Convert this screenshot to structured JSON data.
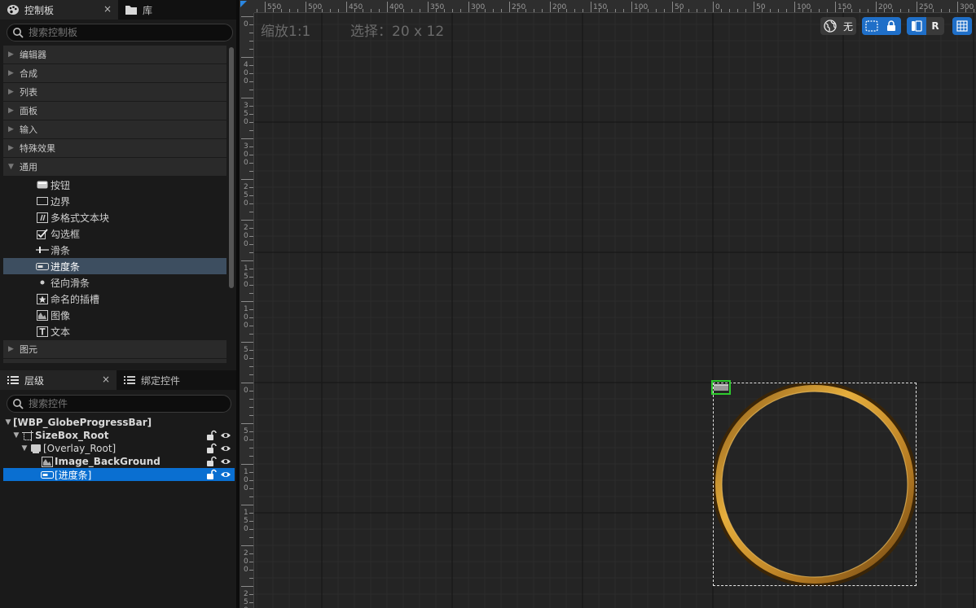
{
  "palette_panel": {
    "tab_label": "控制板",
    "library_tab_label": "库",
    "close_symbol": "×",
    "search_placeholder": "搜索控制板",
    "categories_top": [
      "编辑器",
      "合成",
      "列表",
      "面板",
      "输入",
      "特殊效果"
    ],
    "expanded_category": "通用",
    "widgets": [
      "按钮",
      "边界",
      "多格式文本块",
      "勾选框",
      "滑条",
      "进度条",
      "径向滑条",
      "命名的插槽",
      "图像",
      "文本"
    ],
    "selected_widget": "进度条",
    "categories_bottom": [
      "图元"
    ]
  },
  "hierarchy_panel": {
    "tab_label": "层级",
    "binding_tab_label": "绑定控件",
    "close_symbol": "×",
    "search_placeholder": "搜索控件",
    "items": [
      {
        "label": "[WBP_GlobeProgressBar]",
        "depth": 0
      },
      {
        "label": "SizeBox_Root",
        "depth": 1
      },
      {
        "label": "[Overlay_Root]",
        "depth": 2
      },
      {
        "label": "Image_BackGround",
        "depth": 3
      },
      {
        "label": "[进度条]",
        "depth": 3
      }
    ]
  },
  "designer": {
    "zoom_label": "缩放1:1",
    "selection_label": "选择：20 x 12",
    "toolbar": {
      "world_label": "无",
      "reset_label": "R"
    },
    "ruler_top_labels": [
      "550",
      "500",
      "450",
      "400",
      "350",
      "300",
      "250",
      "200",
      "150",
      "100",
      "50",
      "0",
      "50",
      "100",
      "150",
      "200",
      "250",
      "300"
    ],
    "ruler_left_labels": [
      "0",
      "400",
      "350",
      "300",
      "250",
      "200",
      "150",
      "100",
      "50",
      "0",
      "50",
      "100",
      "150",
      "200",
      "250"
    ]
  },
  "colors": {
    "accent_blue": "#0a6fd1",
    "palette_selection": "#3d4e60",
    "ring_gold": "#d29a2c",
    "selection_green": "#2ecc2e"
  }
}
